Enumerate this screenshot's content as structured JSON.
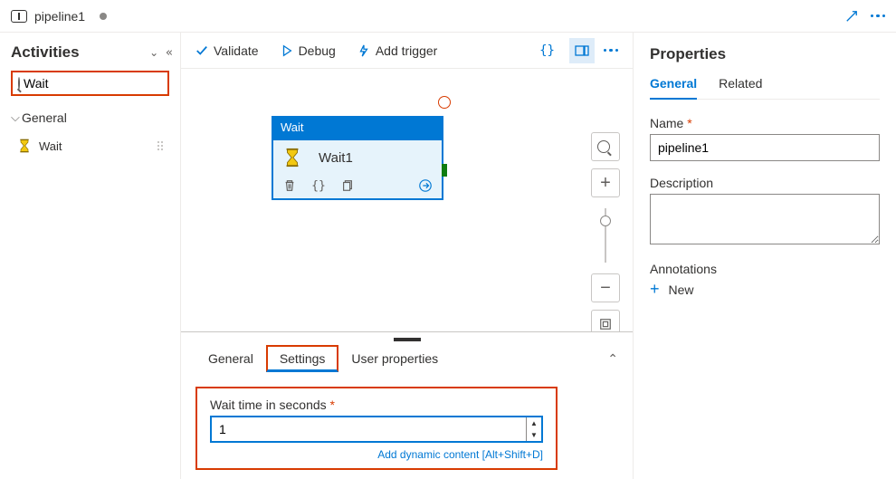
{
  "tab": {
    "title": "pipeline1"
  },
  "sidebar": {
    "title": "Activities",
    "search_value": "Wait",
    "category": "General",
    "item": "Wait"
  },
  "toolbar": {
    "validate": "Validate",
    "debug": "Debug",
    "trigger": "Add trigger",
    "code_label": "{}"
  },
  "activity": {
    "type": "Wait",
    "name": "Wait1"
  },
  "bottom": {
    "tabs": {
      "general": "General",
      "settings": "Settings",
      "user": "User properties"
    },
    "wait_label": "Wait time in seconds",
    "wait_value": "1",
    "dyn_link": "Add dynamic content [Alt+Shift+D]"
  },
  "props": {
    "title": "Properties",
    "tabs": {
      "general": "General",
      "related": "Related"
    },
    "name_lbl": "Name",
    "name_val": "pipeline1",
    "desc_lbl": "Description",
    "annot_lbl": "Annotations",
    "new_lbl": "New"
  }
}
